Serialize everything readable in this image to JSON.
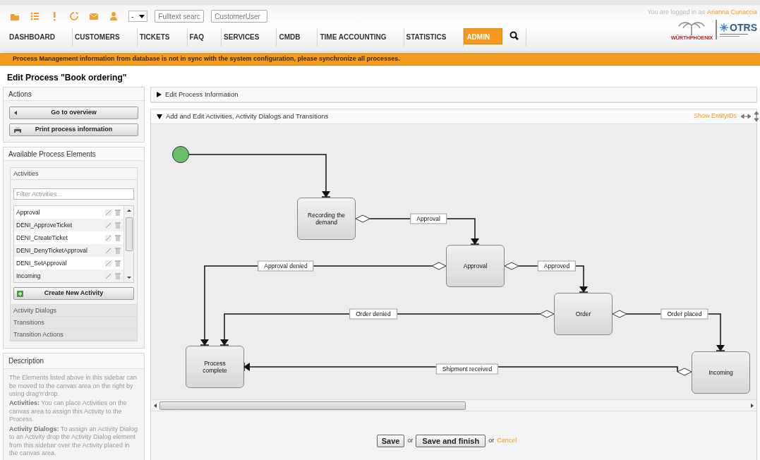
{
  "header": {
    "queue_select": "-",
    "search_placeholder": "Fulltext searc",
    "customer_placeholder": "CustomerUser",
    "login_prefix": "You are logged in as",
    "user_name": "Arianna Cunaccia",
    "logo_brand": "WÜRTHPHOENIX",
    "logo_otrs": "OTRS"
  },
  "nav": [
    {
      "label": "DASHBOARD",
      "selected": false
    },
    {
      "label": "CUSTOMERS",
      "selected": false
    },
    {
      "label": "TICKETS",
      "selected": false
    },
    {
      "label": "FAQ",
      "selected": false
    },
    {
      "label": "SERVICES",
      "selected": false
    },
    {
      "label": "CMDB",
      "selected": false
    },
    {
      "label": "TIME ACCOUNTING",
      "selected": false
    },
    {
      "label": "STATISTICS",
      "selected": false
    },
    {
      "label": "ADMIN",
      "selected": true
    }
  ],
  "notice": "Process Management information from database is not in sync with the system configuration, please synchronize all processes.",
  "page_title": "Edit Process \"Book ordering\"",
  "sidebar": {
    "actions": {
      "title": "Actions",
      "buttons": [
        {
          "label": "Go to overview",
          "kind": "back"
        },
        {
          "label": "Print process information",
          "kind": "print"
        }
      ]
    },
    "elements": {
      "title": "Available Process Elements",
      "sections": [
        {
          "label": "Activities",
          "expanded": true
        },
        {
          "label": "Activity Dialogs",
          "expanded": false
        },
        {
          "label": "Transitions",
          "expanded": false
        },
        {
          "label": "Transition Actions",
          "expanded": false
        }
      ],
      "filter_placeholder": "Filter Activities...",
      "activities": [
        "Approval",
        "DENI_ApproveTicket",
        "DENI_CreateTicket",
        "DENI_DenyTicketApproval",
        "DENI_SetApproval",
        "Incoming"
      ],
      "create_button": "Create New Activity"
    },
    "description": {
      "title": "Description",
      "paragraphs": [
        "The Elements listed above in this sidebar can be moved to the canvas area on the right by using drag'n'drop.",
        "**Activities:** You can place Activities on the canvas area to assign this Activity to the Process.",
        "**Activity Dialogs:** To assign an Activity Dialog to an Activity drop the Activity Dialog element from this sidebar over the Activity placed in the canvas area."
      ]
    }
  },
  "main": {
    "sections": [
      {
        "title": "Edit Process Information",
        "expanded": false
      },
      {
        "title": "Add and Edit Activities, Activity Dialogs and Transitions",
        "expanded": true
      }
    ],
    "show_entity_ids": "Show EntityIDs",
    "diagram": {
      "activities": [
        "Recording the demand",
        "Approval",
        "Order",
        "Process complete",
        "Incoming"
      ],
      "transitions": [
        "Approval",
        "Approved",
        "Approval denied",
        "Order denied",
        "Order placed",
        "Shipment received"
      ]
    },
    "footer": {
      "save": "Save",
      "or_1": "or",
      "save_finish": "Save and finish",
      "or_2": "or",
      "cancel": "Cancel"
    }
  }
}
